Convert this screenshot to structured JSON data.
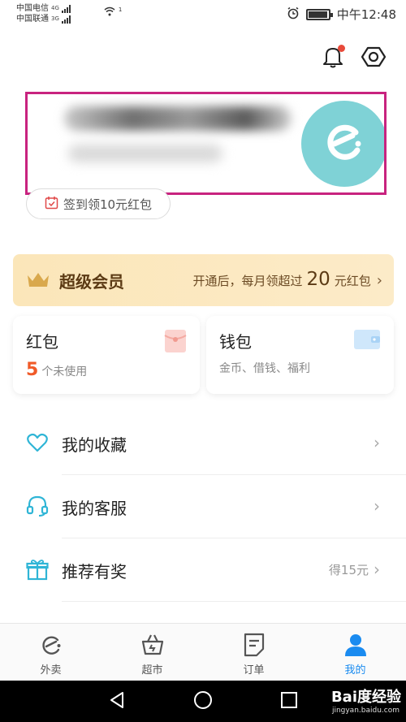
{
  "status_bar": {
    "carrier1": "中国电信",
    "carrier1_tag": "4G",
    "carrier2": "中国联通",
    "carrier2_tag": "3G",
    "wifi_tag": "1",
    "time": "中午12:48",
    "battery_level": 0.95
  },
  "header": {
    "notification_icon": "bell-icon",
    "settings_icon": "gear-icon",
    "has_unread": true
  },
  "profile": {
    "avatar_icon": "eleme-logo-icon",
    "signin_label": "签到领10元红包"
  },
  "vip": {
    "title": "超级会员",
    "desc_prefix": "开通后，每月领超过",
    "amount": "20",
    "desc_suffix": "元红包"
  },
  "cards": {
    "hongbao": {
      "title": "红包",
      "count": "5",
      "sub": "个未使用"
    },
    "wallet": {
      "title": "钱包",
      "sub": "金币、借钱、福利"
    }
  },
  "menu": [
    {
      "label": "我的收藏",
      "icon": "heart-icon",
      "right": ""
    },
    {
      "label": "我的客服",
      "icon": "headset-icon",
      "right": ""
    },
    {
      "label": "推荐有奖",
      "icon": "gift-icon",
      "right": "得15元"
    }
  ],
  "tabs": [
    {
      "label": "外卖",
      "icon": "eleme-tab-icon",
      "active": false
    },
    {
      "label": "超市",
      "icon": "basket-icon",
      "active": false
    },
    {
      "label": "订单",
      "icon": "order-list-icon",
      "active": false
    },
    {
      "label": "我的",
      "icon": "person-icon",
      "active": true
    }
  ],
  "watermark": {
    "brand": "Bai度经验",
    "url": "jingyan.baidu.com"
  },
  "colors": {
    "accent_blue": "#1a8bf0",
    "highlight_box": "#c8237f",
    "vip_bg": "#fbe6b9",
    "count_orange": "#f05a28"
  }
}
